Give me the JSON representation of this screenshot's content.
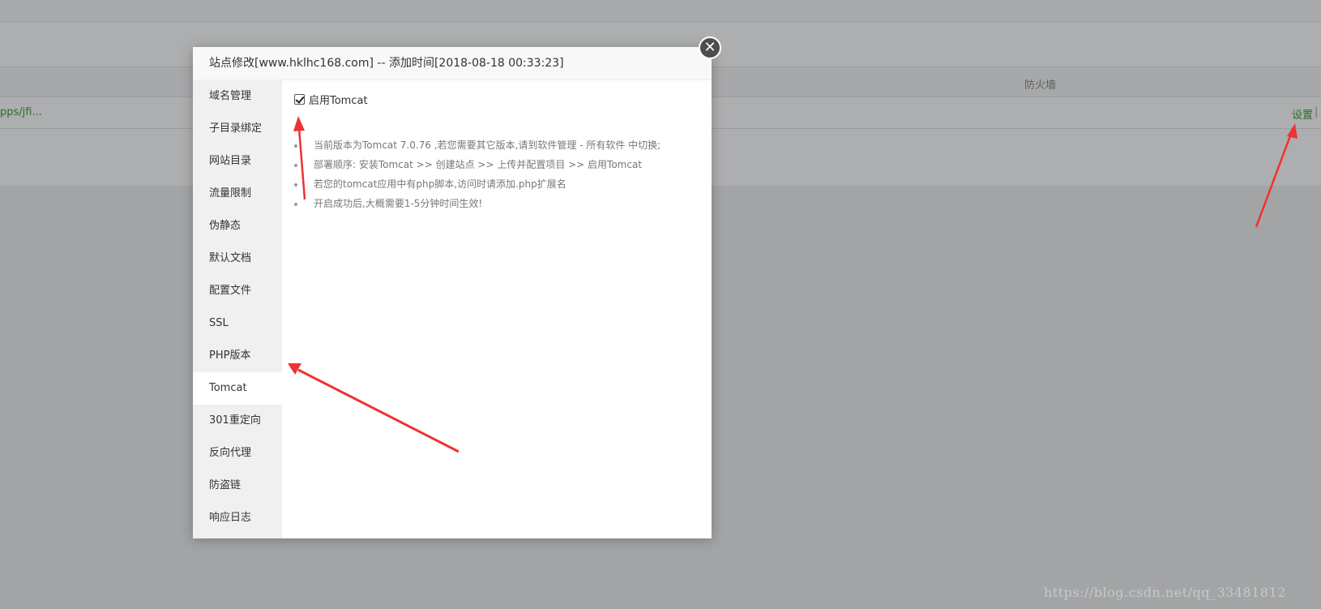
{
  "background": {
    "firewall_header": "防火墙",
    "site_path": "pps/jfi...",
    "settings_link": "设置",
    "separator": "|"
  },
  "modal": {
    "title": "站点修改[www.hklhc168.com] -- 添加时间[2018-08-18 00:33:23]",
    "close_icon": "close-icon",
    "sidebar": {
      "items": [
        {
          "label": "域名管理"
        },
        {
          "label": "子目录绑定"
        },
        {
          "label": "网站目录"
        },
        {
          "label": "流量限制"
        },
        {
          "label": "伪静态"
        },
        {
          "label": "默认文档"
        },
        {
          "label": "配置文件"
        },
        {
          "label": "SSL"
        },
        {
          "label": "PHP版本"
        },
        {
          "label": "Tomcat"
        },
        {
          "label": "301重定向"
        },
        {
          "label": "反向代理"
        },
        {
          "label": "防盗链"
        },
        {
          "label": "响应日志"
        }
      ],
      "active_index": 9
    },
    "content": {
      "enable_label": "启用Tomcat",
      "enable_checked": true,
      "tips": [
        "当前版本为Tomcat 7.0.76 ,若您需要其它版本,请到软件管理 - 所有软件 中切换;",
        "部署顺序: 安装Tomcat >> 创建站点 >> 上传并配置项目 >> 启用Tomcat",
        "若您的tomcat应用中有php脚本,访问时请添加.php扩展名",
        "开启成功后,大概需要1-5分钟时间生效!"
      ]
    }
  },
  "watermark": "https://blog.csdn.net/qq_33481812",
  "colors": {
    "overlay": "#a2a4a6",
    "arrow": "#f03232",
    "link_green": "#2c6b2e"
  }
}
